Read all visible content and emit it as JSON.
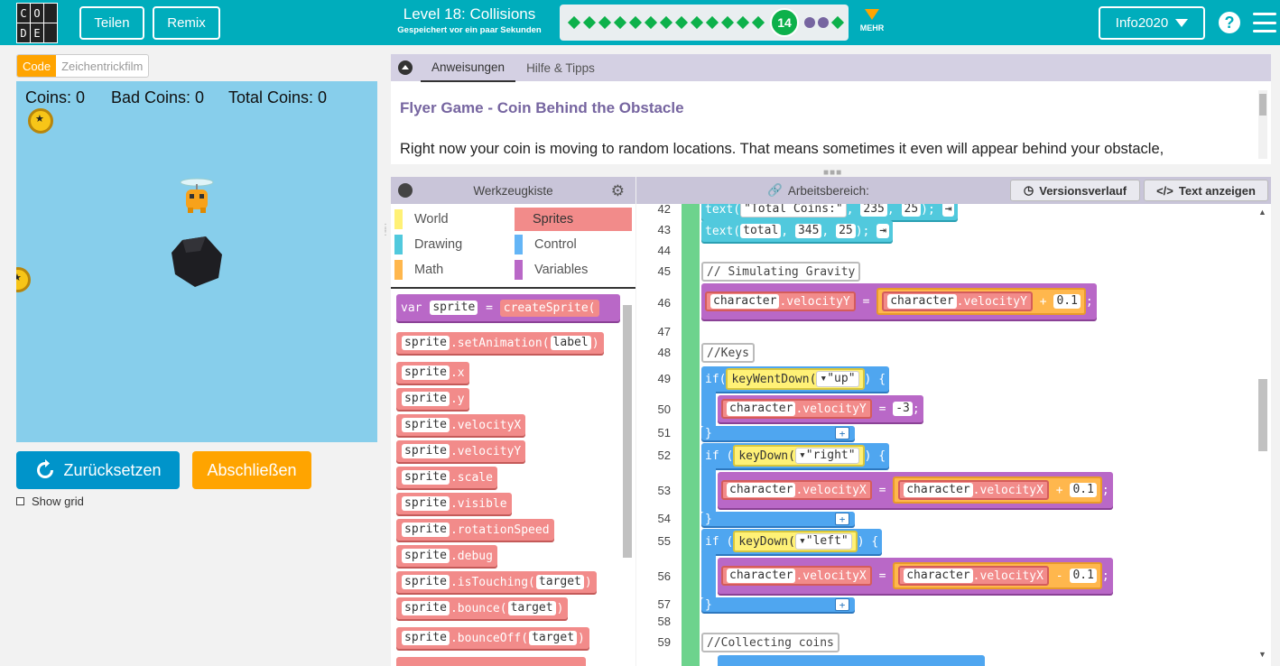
{
  "header": {
    "logo_letters": [
      "C",
      "O",
      "D",
      "E"
    ],
    "share_label": "Teilen",
    "remix_label": "Remix",
    "level_title": "Level 18: Collisions",
    "saved_status": "Gespeichert vor ein paar Sekunden",
    "current_level": "14",
    "more_label": "MEHR",
    "account_label": "Info2020",
    "help_label": "?",
    "brand_color": "#00adbc"
  },
  "view_toggle": {
    "code_label": "Code",
    "animation_label": "Zeichentrickfilm"
  },
  "stage": {
    "coins_label": "Coins: 0",
    "bad_coins_label": "Bad Coins: 0",
    "total_coins_label": "Total Coins: 0"
  },
  "controls": {
    "reset_label": "Zurücksetzen",
    "finish_label": "Abschließen",
    "show_grid_label": "Show grid"
  },
  "instructions": {
    "tab_instructions": "Anweisungen",
    "tab_hints": "Hilfe & Tipps",
    "title": "Flyer Game - Coin Behind the Obstacle",
    "text": "Right now your coin is moving to random locations. That means sometimes it even will appear behind your obstacle,"
  },
  "toolbox": {
    "title": "Werkzeugkiste",
    "categories": [
      {
        "label": "World",
        "color": "#fff176"
      },
      {
        "label": "Sprites",
        "color": "#f28b8a"
      },
      {
        "label": "Drawing",
        "color": "#51c9dd"
      },
      {
        "label": "Control",
        "color": "#64b5f6"
      },
      {
        "label": "Math",
        "color": "#ffb74d"
      },
      {
        "label": "Variables",
        "color": "#b968c7"
      }
    ],
    "blocks": {
      "var_kw": "var",
      "var_name": "sprite",
      "eq": "=",
      "create_sprite": "createSprite(",
      "sprite": "sprite",
      "set_animation": ".setAnimation(",
      "label_arg": "label",
      "close": ")",
      "x": ".x",
      "y": ".y",
      "velocity_x": ".velocityX",
      "velocity_y": ".velocityY",
      "scale": ".scale",
      "visible": ".visible",
      "rotation_speed": ".rotationSpeed",
      "debug": ".debug",
      "is_touching": ".isTouching(",
      "bounce": ".bounce(",
      "bounce_off": ".bounceOff(",
      "target_arg": "target"
    }
  },
  "workspace": {
    "title": "Arbeitsbereich:",
    "version_history_label": "Versionsverlauf",
    "show_text_label": "Text anzeigen",
    "line_numbers": [
      "42",
      "43",
      "44",
      "45",
      "46",
      "47",
      "48",
      "49",
      "50",
      "51",
      "52",
      "53",
      "54",
      "55",
      "56",
      "57",
      "58",
      "59"
    ],
    "code": {
      "text_fn": "text(",
      "total_coins_str": "\"Total Coins:\"",
      "comma": ",",
      "n235": "235",
      "n25": "25",
      "close_semi": ");",
      "total_var": "total",
      "n345": "345",
      "comment_gravity": "// Simulating Gravity",
      "character": "character",
      "velocity_y": ".velocityY",
      "velocity_x": ".velocityX",
      "eq": "=",
      "plus": "+",
      "minus": "-",
      "n01": "0.1",
      "semi": ";",
      "comment_keys": "//Keys",
      "if_kw": "if (",
      "if_kw_tight": "if(",
      "key_went_down": "keyWentDown(",
      "key_down": "keyDown(",
      "up_str": "\"up\"",
      "right_str": "\"right\"",
      "left_str": "\"left\"",
      "close_brace_open": ") {",
      "n_minus3": "-3",
      "close_brace": "}",
      "comment_collect": "//Collecting coins",
      "plus_btn": "+"
    }
  }
}
